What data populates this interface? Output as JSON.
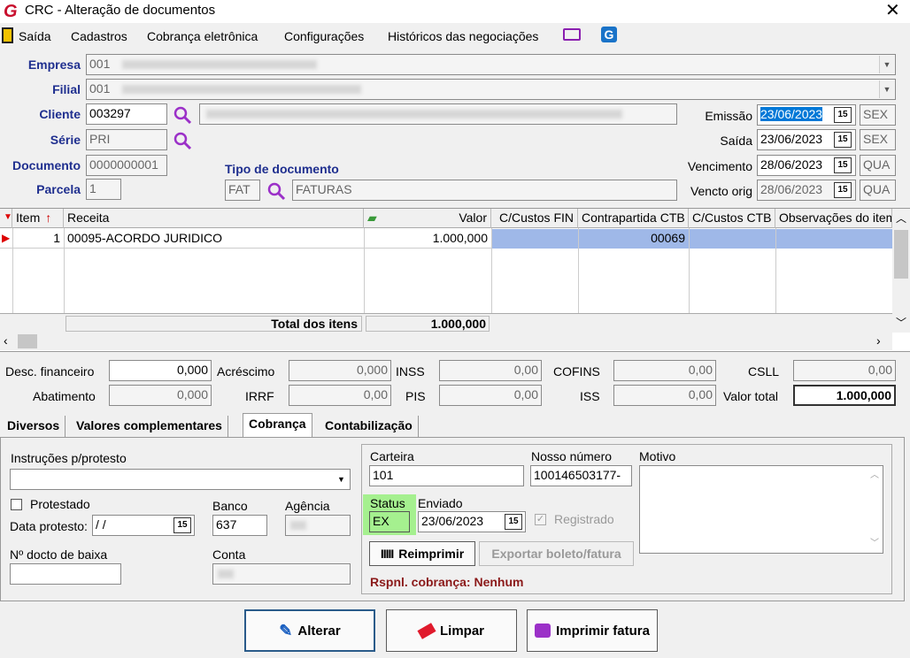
{
  "window": {
    "title": "CRC - Alteração de documentos"
  },
  "menu": {
    "exit": "Saída",
    "items": [
      "Cadastros",
      "Cobrança eletrônica",
      "Configurações",
      "Históricos das negociações"
    ]
  },
  "header": {
    "empresa_label": "Empresa",
    "empresa_code": "001",
    "filial_label": "Filial",
    "filial_code": "001",
    "cliente_label": "Cliente",
    "cliente_code": "003297",
    "serie_label": "Série",
    "serie_value": "PRI",
    "documento_label": "Documento",
    "documento_value": "0000000001",
    "parcela_label": "Parcela",
    "parcela_value": "1",
    "tipo_label": "Tipo de documento",
    "tipo_code": "FAT",
    "tipo_desc": "FATURAS",
    "emissao_label": "Emissão",
    "emissao_date": "23/06/2023",
    "emissao_day": "SEX",
    "saida_label": "Saída",
    "saida_date": "23/06/2023",
    "saida_day": "SEX",
    "vencimento_label": "Vencimento",
    "vencimento_date": "28/06/2023",
    "vencimento_day": "QUA",
    "vencto_orig_label": "Vencto orig",
    "vencto_orig_date": "28/06/2023",
    "vencto_orig_day": "QUA",
    "cal_glyph": "15"
  },
  "grid": {
    "columns": [
      "Item",
      "Receita",
      "Valor",
      "C/Custos FIN",
      "Contrapartida CTB",
      "C/Custos CTB",
      "Observações do item"
    ],
    "row": {
      "item": "1",
      "receita": "00095-ACORDO JURIDICO",
      "valor": "1.000,000",
      "ccustos_fin": "",
      "contrapartida": "00069",
      "ccustos_ctb": "",
      "obs": ""
    },
    "total_label": "Total dos itens",
    "total_value": "1.000,000"
  },
  "totals": {
    "desc_fin_label": "Desc. financeiro",
    "desc_fin": "0,000",
    "acrescimo_label": "Acréscimo",
    "acrescimo": "0,000",
    "inss_label": "INSS",
    "inss": "0,00",
    "cofins_label": "COFINS",
    "cofins": "0,00",
    "csll_label": "CSLL",
    "csll": "0,00",
    "abatimento_label": "Abatimento",
    "abatimento": "0,000",
    "irrf_label": "IRRF",
    "irrf": "0,00",
    "pis_label": "PIS",
    "pis": "0,00",
    "iss_label": "ISS",
    "iss": "0,00",
    "valor_total_label": "Valor total",
    "valor_total": "1.000,000"
  },
  "tabs": [
    "Diversos",
    "Valores complementares",
    "Cobrança",
    "Contabilização"
  ],
  "cobranca": {
    "instrucoes_label": "Instruções p/protesto",
    "protestado_label": "Protestado",
    "data_protesto_label": "Data protesto:",
    "data_protesto": " /  /",
    "banco_label": "Banco",
    "banco": "637",
    "agencia_label": "Agência",
    "docto_baixa_label": "Nº docto de baixa",
    "conta_label": "Conta",
    "carteira_label": "Carteira",
    "carteira": "101",
    "nosso_numero_label": "Nosso número",
    "nosso_numero": "100146503177-",
    "motivo_label": "Motivo",
    "status_label": "Status",
    "status": "EX",
    "enviado_label": "Enviado",
    "enviado": "23/06/2023",
    "registrado_label": "Registrado",
    "reimprimir_label": "Reimprimir",
    "exportar_label": "Exportar boleto/fatura",
    "responsavel": "Rspnl. cobrança: Nenhum"
  },
  "buttons": {
    "alterar": "Alterar",
    "limpar": "Limpar",
    "imprimir": "Imprimir fatura"
  }
}
